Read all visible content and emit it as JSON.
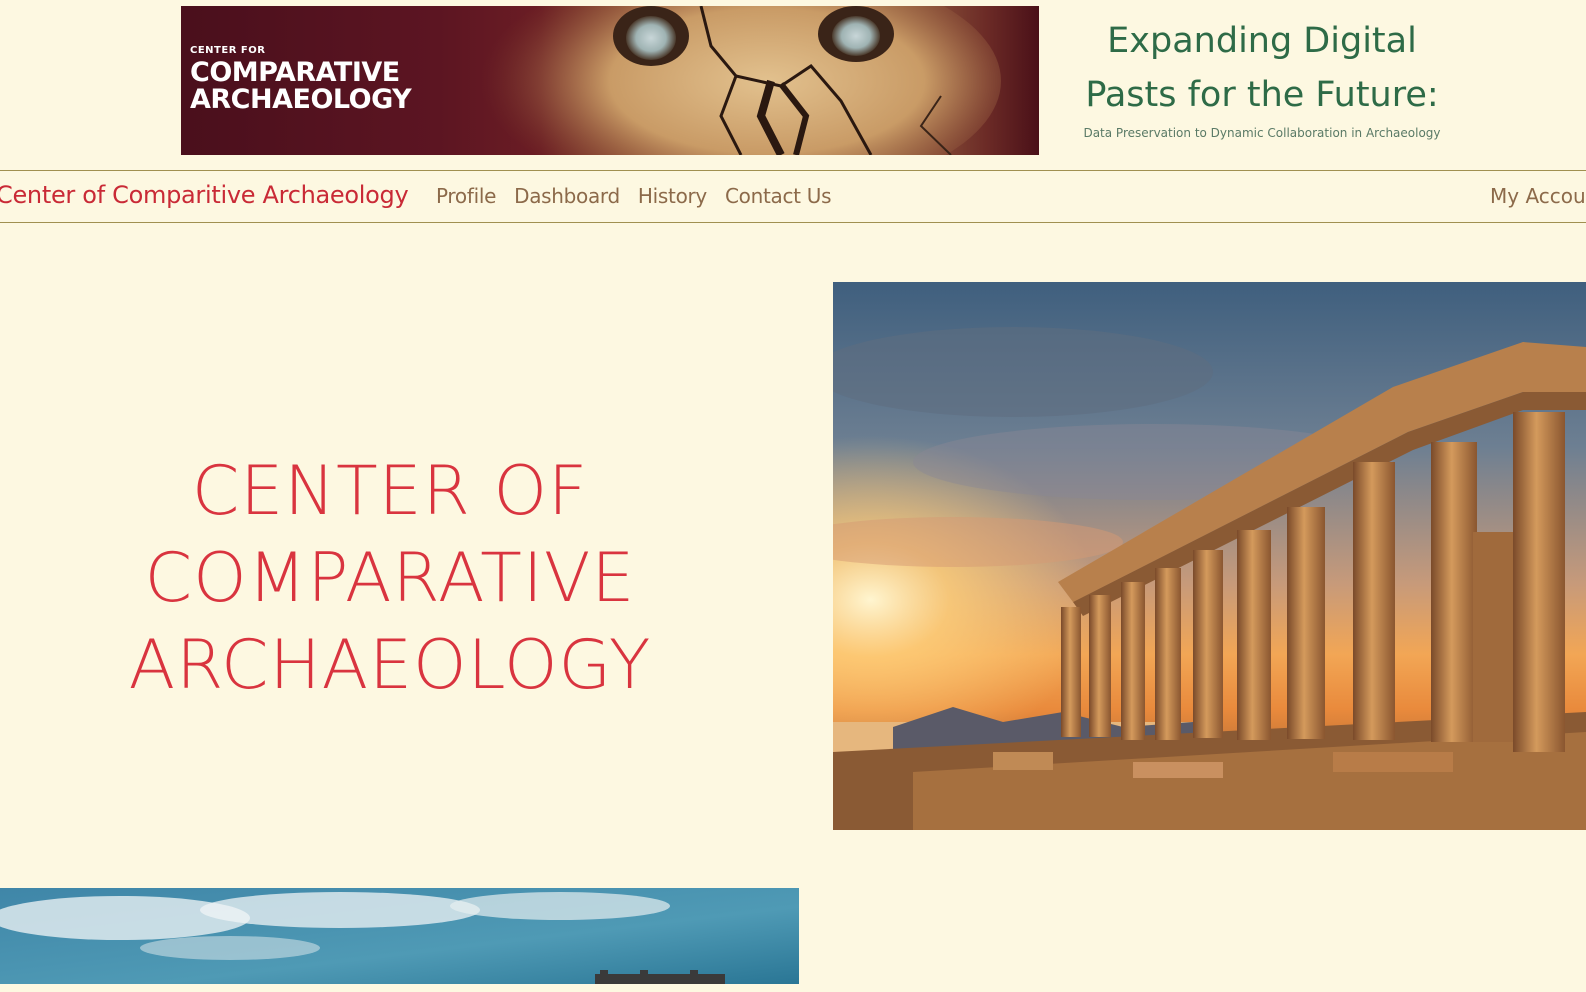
{
  "banner": {
    "logo_small": "CENTER FOR",
    "logo_line1": "COMPARATIVE",
    "logo_line2": "ARCHAEOLOGY"
  },
  "tagline": {
    "title_line1": "Expanding Digital",
    "title_line2": "Pasts for the Future:",
    "subtitle": "Data Preservation to Dynamic Collaboration in Archaeology"
  },
  "nav": {
    "brand": "Center of Comparitive Archaeology",
    "links": [
      "Profile",
      "Dashboard",
      "History",
      "Contact Us"
    ],
    "account": "My Account"
  },
  "hero": {
    "title_line1": "CENTER OF",
    "title_line2": "COMPARATIVE",
    "title_line3": "ARCHAEOLOGY"
  },
  "colors": {
    "background": "#fdf8e1",
    "brand_red": "#c92a36",
    "tagline_green": "#2e6b47",
    "nav_text": "#8c6a4a",
    "nav_border": "#a09050"
  }
}
